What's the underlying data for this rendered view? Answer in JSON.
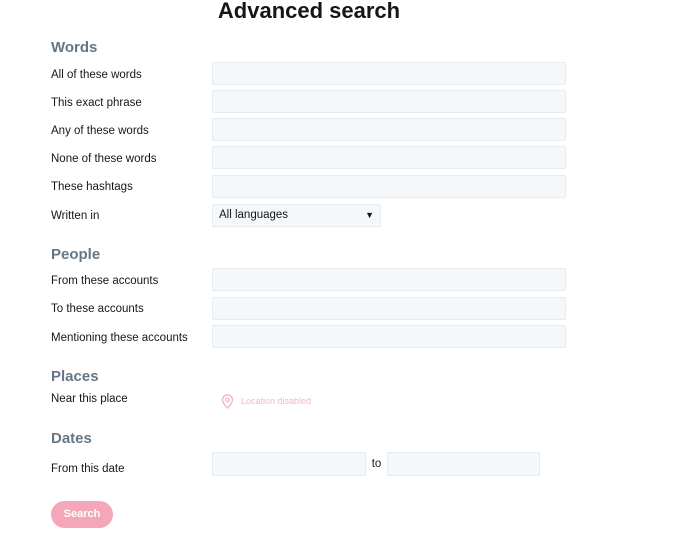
{
  "title": "Advanced search",
  "sections": {
    "words": {
      "heading": "Words",
      "all_words": {
        "label": "All of these words",
        "value": ""
      },
      "exact_phrase": {
        "label": "This exact phrase",
        "value": ""
      },
      "any_words": {
        "label": "Any of these words",
        "value": ""
      },
      "none_words": {
        "label": "None of these words",
        "value": ""
      },
      "hashtags": {
        "label": "These hashtags",
        "value": ""
      },
      "language": {
        "label": "Written in",
        "value": "All languages",
        "icon": "caret-down-icon"
      }
    },
    "people": {
      "heading": "People",
      "from_accounts": {
        "label": "From these accounts",
        "value": ""
      },
      "to_accounts": {
        "label": "To these accounts",
        "value": ""
      },
      "mentioning_accounts": {
        "label": "Mentioning these accounts",
        "value": ""
      }
    },
    "places": {
      "heading": "Places",
      "near": {
        "label": "Near this place",
        "status": "Location disabled",
        "icon": "location-pin-icon"
      }
    },
    "dates": {
      "heading": "Dates",
      "from_date": {
        "label": "From this date",
        "start": "",
        "separator": "to",
        "end": ""
      }
    }
  },
  "search_button": {
    "label": "Search"
  },
  "colors": {
    "accent_disabled": "#f4a7b9",
    "heading": "#657786",
    "field_bg": "#f5f8fa"
  }
}
